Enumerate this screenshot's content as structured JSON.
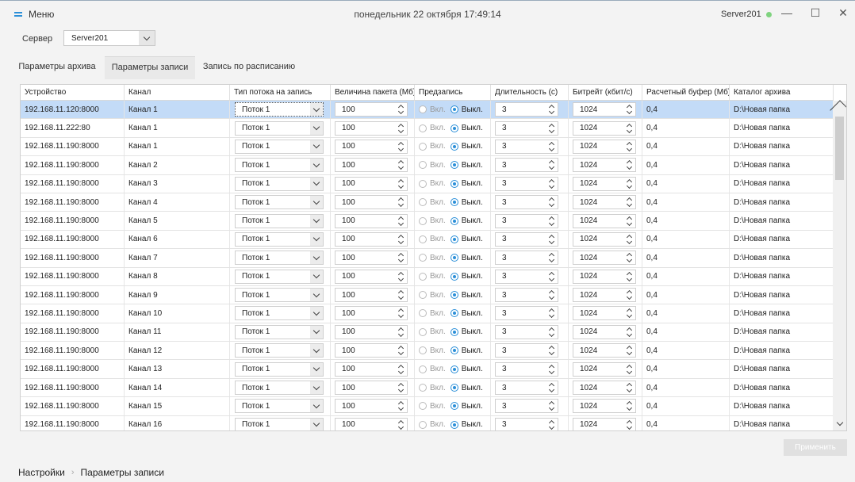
{
  "titlebar": {
    "menu_label": "Меню",
    "datetime": "понедельник 22 октября 17:49:14",
    "server_name": "Server201",
    "status_color": "#7fd37f",
    "minimize_glyph": "—",
    "maximize_glyph": "☐",
    "close_glyph": "✕"
  },
  "server": {
    "label": "Сервер",
    "value": "Server201"
  },
  "tabs": [
    {
      "label": "Параметры архива",
      "active": false
    },
    {
      "label": "Параметры записи",
      "active": true
    },
    {
      "label": "Запись по расписанию",
      "active": false
    }
  ],
  "table": {
    "headers": [
      "Устройство",
      "Канал",
      "Тип потока на запись",
      "Величина пакета (Мб)",
      "Предзапись",
      "Длительность (с)",
      "Битрейт (кбит/с)",
      "Расчетный буфер (Мб)",
      "Каталог архива"
    ],
    "radio_on_label": "Вкл.",
    "radio_off_label": "Выкл.",
    "rows": [
      {
        "device": "192.168.11.120:8000",
        "channel": "Канал 1",
        "stream": "Поток 1",
        "packet": "100",
        "prerecord": "off",
        "duration": "3",
        "bitrate": "1024",
        "buffer": "0,4",
        "folder": "D:\\Новая папка",
        "selected": true
      },
      {
        "device": "192.168.11.222:80",
        "channel": "Канал 1",
        "stream": "Поток 1",
        "packet": "100",
        "prerecord": "off",
        "duration": "3",
        "bitrate": "1024",
        "buffer": "0,4",
        "folder": "D:\\Новая папка"
      },
      {
        "device": "192.168.11.190:8000",
        "channel": "Канал 1",
        "stream": "Поток 1",
        "packet": "100",
        "prerecord": "off",
        "duration": "3",
        "bitrate": "1024",
        "buffer": "0,4",
        "folder": "D:\\Новая папка"
      },
      {
        "device": "192.168.11.190:8000",
        "channel": "Канал 2",
        "stream": "Поток 1",
        "packet": "100",
        "prerecord": "off",
        "duration": "3",
        "bitrate": "1024",
        "buffer": "0,4",
        "folder": "D:\\Новая папка"
      },
      {
        "device": "192.168.11.190:8000",
        "channel": "Канал 3",
        "stream": "Поток 1",
        "packet": "100",
        "prerecord": "off",
        "duration": "3",
        "bitrate": "1024",
        "buffer": "0,4",
        "folder": "D:\\Новая папка"
      },
      {
        "device": "192.168.11.190:8000",
        "channel": "Канал 4",
        "stream": "Поток 1",
        "packet": "100",
        "prerecord": "off",
        "duration": "3",
        "bitrate": "1024",
        "buffer": "0,4",
        "folder": "D:\\Новая папка"
      },
      {
        "device": "192.168.11.190:8000",
        "channel": "Канал 5",
        "stream": "Поток 1",
        "packet": "100",
        "prerecord": "off",
        "duration": "3",
        "bitrate": "1024",
        "buffer": "0,4",
        "folder": "D:\\Новая папка"
      },
      {
        "device": "192.168.11.190:8000",
        "channel": "Канал 6",
        "stream": "Поток 1",
        "packet": "100",
        "prerecord": "off",
        "duration": "3",
        "bitrate": "1024",
        "buffer": "0,4",
        "folder": "D:\\Новая папка"
      },
      {
        "device": "192.168.11.190:8000",
        "channel": "Канал 7",
        "stream": "Поток 1",
        "packet": "100",
        "prerecord": "off",
        "duration": "3",
        "bitrate": "1024",
        "buffer": "0,4",
        "folder": "D:\\Новая папка"
      },
      {
        "device": "192.168.11.190:8000",
        "channel": "Канал 8",
        "stream": "Поток 1",
        "packet": "100",
        "prerecord": "off",
        "duration": "3",
        "bitrate": "1024",
        "buffer": "0,4",
        "folder": "D:\\Новая папка"
      },
      {
        "device": "192.168.11.190:8000",
        "channel": "Канал 9",
        "stream": "Поток 1",
        "packet": "100",
        "prerecord": "off",
        "duration": "3",
        "bitrate": "1024",
        "buffer": "0,4",
        "folder": "D:\\Новая папка"
      },
      {
        "device": "192.168.11.190:8000",
        "channel": "Канал 10",
        "stream": "Поток 1",
        "packet": "100",
        "prerecord": "off",
        "duration": "3",
        "bitrate": "1024",
        "buffer": "0,4",
        "folder": "D:\\Новая папка"
      },
      {
        "device": "192.168.11.190:8000",
        "channel": "Канал 11",
        "stream": "Поток 1",
        "packet": "100",
        "prerecord": "off",
        "duration": "3",
        "bitrate": "1024",
        "buffer": "0,4",
        "folder": "D:\\Новая папка"
      },
      {
        "device": "192.168.11.190:8000",
        "channel": "Канал 12",
        "stream": "Поток 1",
        "packet": "100",
        "prerecord": "off",
        "duration": "3",
        "bitrate": "1024",
        "buffer": "0,4",
        "folder": "D:\\Новая папка"
      },
      {
        "device": "192.168.11.190:8000",
        "channel": "Канал 13",
        "stream": "Поток 1",
        "packet": "100",
        "prerecord": "off",
        "duration": "3",
        "bitrate": "1024",
        "buffer": "0,4",
        "folder": "D:\\Новая папка"
      },
      {
        "device": "192.168.11.190:8000",
        "channel": "Канал 14",
        "stream": "Поток 1",
        "packet": "100",
        "prerecord": "off",
        "duration": "3",
        "bitrate": "1024",
        "buffer": "0,4",
        "folder": "D:\\Новая папка"
      },
      {
        "device": "192.168.11.190:8000",
        "channel": "Канал 15",
        "stream": "Поток 1",
        "packet": "100",
        "prerecord": "off",
        "duration": "3",
        "bitrate": "1024",
        "buffer": "0,4",
        "folder": "D:\\Новая папка"
      },
      {
        "device": "192.168.11.190:8000",
        "channel": "Канал 16",
        "stream": "Поток 1",
        "packet": "100",
        "prerecord": "off",
        "duration": "3",
        "bitrate": "1024",
        "buffer": "0,4",
        "folder": "D:\\Новая папка"
      }
    ]
  },
  "apply_label": "Применить",
  "breadcrumb": {
    "root": "Настройки",
    "separator": "›",
    "current": "Параметры записи"
  }
}
